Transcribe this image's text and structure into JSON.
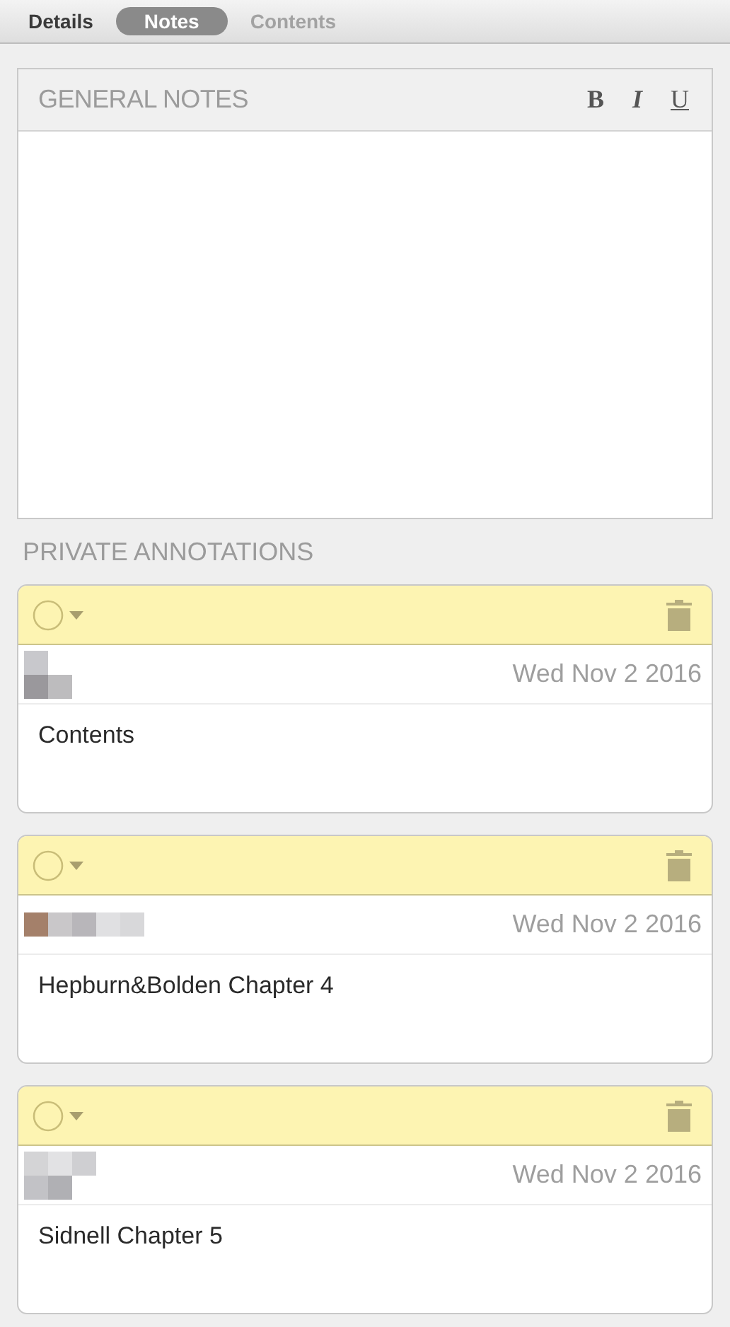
{
  "tabs": [
    {
      "label": "Details",
      "selected": false,
      "disabled": false
    },
    {
      "label": "Notes",
      "selected": true,
      "disabled": false
    },
    {
      "label": "Contents",
      "selected": false,
      "disabled": true
    }
  ],
  "general_notes": {
    "title": "GENERAL NOTES",
    "format_buttons": [
      "B",
      "I",
      "U"
    ]
  },
  "private_annotations": {
    "title": "PRIVATE ANNOTATIONS",
    "items": [
      {
        "author": {
          "kind": "redacted"
        },
        "date": "Wed Nov 2 2016",
        "text": "Contents"
      },
      {
        "author": {
          "kind": "redacted"
        },
        "date": "Wed Nov 2 2016",
        "text": "Hepburn&Bolden Chapter 4"
      },
      {
        "author": {
          "kind": "redacted"
        },
        "date": "Wed Nov 2 2016",
        "text": "Sidnell Chapter 5"
      }
    ]
  }
}
